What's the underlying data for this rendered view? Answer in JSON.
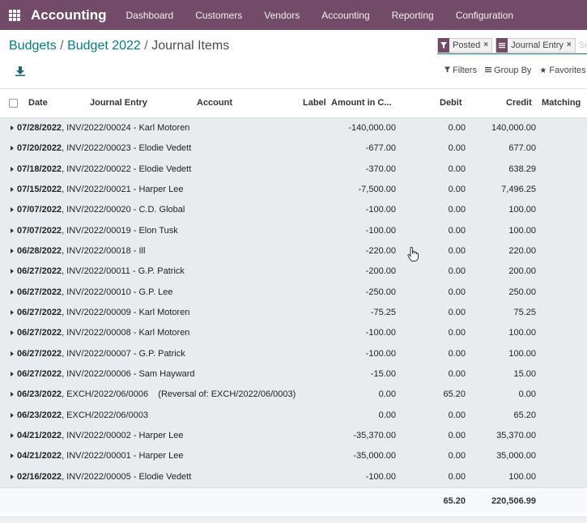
{
  "topbar": {
    "app_title": "Accounting",
    "menu": [
      "Dashboard",
      "Customers",
      "Vendors",
      "Accounting",
      "Reporting",
      "Configuration"
    ]
  },
  "breadcrumb": {
    "level1": "Budgets",
    "level2": "Budget 2022",
    "current": "Journal Items",
    "separator": "/"
  },
  "search": {
    "facets": [
      {
        "icon": "filter-icon",
        "label": "Posted"
      },
      {
        "icon": "group-icon",
        "label": "Journal Entry"
      }
    ],
    "placeholder": "Se"
  },
  "tools": {
    "filters": "Filters",
    "group_by": "Group By",
    "favorites": "Favorites"
  },
  "columns": {
    "date": "Date",
    "journal_entry": "Journal Entry",
    "account": "Account",
    "label": "Label",
    "amount": "Amount in C...",
    "debit": "Debit",
    "credit": "Credit",
    "matching": "Matching"
  },
  "rows": [
    {
      "date": "07/28/2022",
      "entry": ", INV/2022/00024 - Karl Motoren",
      "amount": "-140,000.00",
      "debit": "0.00",
      "credit": "140,000.00"
    },
    {
      "date": "07/20/2022",
      "entry": ", INV/2022/00023 - Elodie Vedett",
      "amount": "-677.00",
      "debit": "0.00",
      "credit": "677.00"
    },
    {
      "date": "07/18/2022",
      "entry": ", INV/2022/00022 - Elodie Vedett",
      "amount": "-370.00",
      "debit": "0.00",
      "credit": "638.29"
    },
    {
      "date": "07/15/2022",
      "entry": ", INV/2022/00021 - Harper Lee",
      "amount": "-7,500.00",
      "debit": "0.00",
      "credit": "7,496.25"
    },
    {
      "date": "07/07/2022",
      "entry": ", INV/2022/00020 - C.D. Global",
      "amount": "-100.00",
      "debit": "0.00",
      "credit": "100.00"
    },
    {
      "date": "07/07/2022",
      "entry": ", INV/2022/00019 - Elon Tusk",
      "amount": "-100.00",
      "debit": "0.00",
      "credit": "100.00"
    },
    {
      "date": "06/28/2022",
      "entry": ", INV/2022/00018 - Ill",
      "amount": "-220.00",
      "debit": "0.00",
      "credit": "220.00"
    },
    {
      "date": "06/27/2022",
      "entry": ", INV/2022/00011 - G.P. Patrick",
      "amount": "-200.00",
      "debit": "0.00",
      "credit": "200.00"
    },
    {
      "date": "06/27/2022",
      "entry": ", INV/2022/00010 - G.P. Lee",
      "amount": "-250.00",
      "debit": "0.00",
      "credit": "250.00"
    },
    {
      "date": "06/27/2022",
      "entry": ", INV/2022/00009 - Karl Motoren",
      "amount": "-75.25",
      "debit": "0.00",
      "credit": "75.25"
    },
    {
      "date": "06/27/2022",
      "entry": ", INV/2022/00008 - Karl Motoren",
      "amount": "-100.00",
      "debit": "0.00",
      "credit": "100.00"
    },
    {
      "date": "06/27/2022",
      "entry": ", INV/2022/00007 - G.P. Patrick",
      "amount": "-100.00",
      "debit": "0.00",
      "credit": "100.00"
    },
    {
      "date": "06/27/2022",
      "entry": ", INV/2022/00006 - Sam Hayward",
      "amount": "-15.00",
      "debit": "0.00",
      "credit": "15.00"
    },
    {
      "date": "06/23/2022",
      "entry": ", EXCH/2022/06/0006    (Reversal of: EXCH/2022/06/0003)",
      "amount": "0.00",
      "debit": "65.20",
      "credit": "0.00"
    },
    {
      "date": "06/23/2022",
      "entry": ", EXCH/2022/06/0003",
      "amount": "0.00",
      "debit": "0.00",
      "credit": "65.20"
    },
    {
      "date": "04/21/2022",
      "entry": ", INV/2022/00002 - Harper Lee",
      "amount": "-35,370.00",
      "debit": "0.00",
      "credit": "35,370.00"
    },
    {
      "date": "04/21/2022",
      "entry": ", INV/2022/00001 - Harper Lee",
      "amount": "-35,000.00",
      "debit": "0.00",
      "credit": "35,000.00"
    },
    {
      "date": "02/16/2022",
      "entry": ", INV/2022/00005 - Elodie Vedett",
      "amount": "-100.00",
      "debit": "0.00",
      "credit": "100.00"
    }
  ],
  "totals": {
    "debit": "65.20",
    "credit": "220,506.99"
  }
}
